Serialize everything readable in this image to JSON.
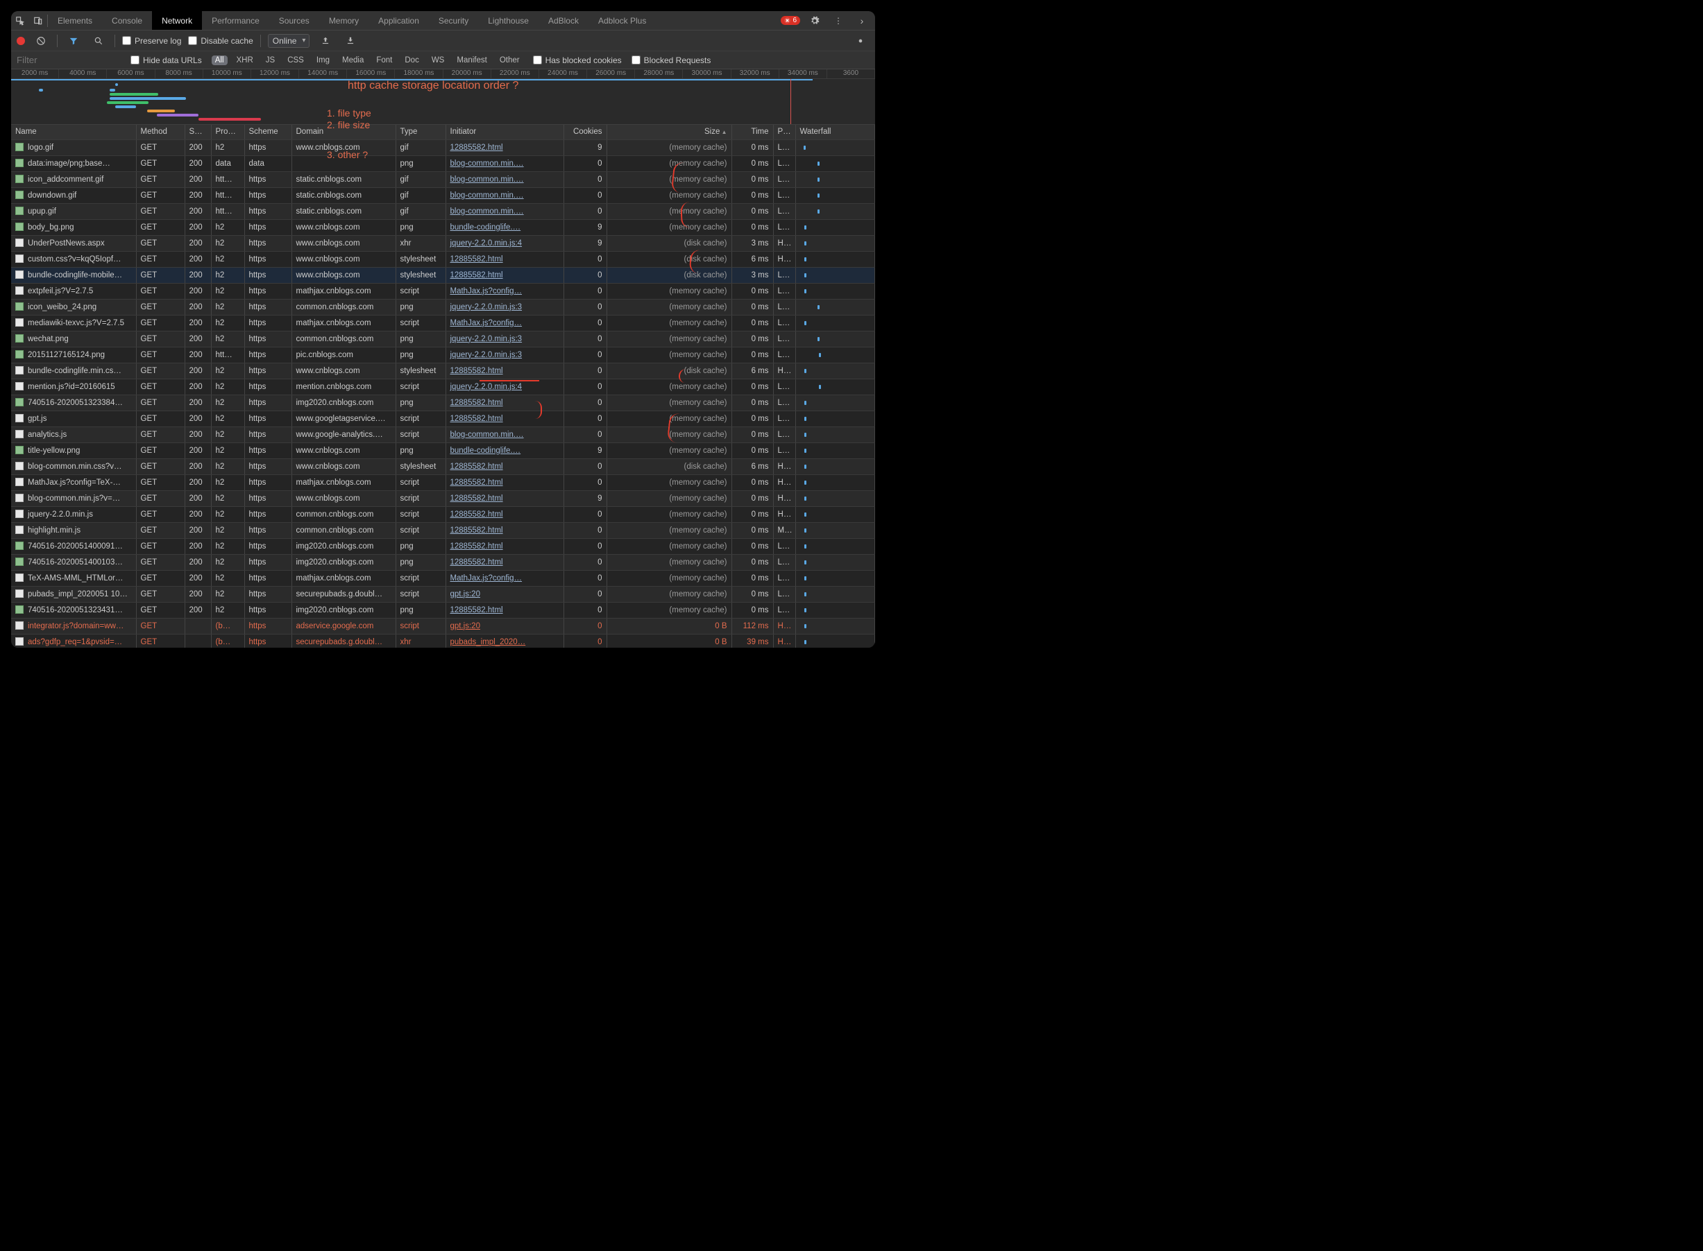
{
  "tabs": {
    "items": [
      "Elements",
      "Console",
      "Network",
      "Performance",
      "Sources",
      "Memory",
      "Application",
      "Security",
      "Lighthouse",
      "AdBlock",
      "Adblock Plus"
    ],
    "active": "Network",
    "error_count": "6"
  },
  "toolbar": {
    "preserve_log": "Preserve log",
    "disable_cache": "Disable cache",
    "throttle": "Online"
  },
  "filterbar": {
    "placeholder": "Filter",
    "hide_data_urls": "Hide data URLs",
    "types": [
      "All",
      "XHR",
      "JS",
      "CSS",
      "Img",
      "Media",
      "Font",
      "Doc",
      "WS",
      "Manifest",
      "Other"
    ],
    "active_type": "All",
    "blocked_cookies": "Has blocked cookies",
    "blocked_requests": "Blocked Requests"
  },
  "overview_ticks": [
    "2000 ms",
    "4000 ms",
    "6000 ms",
    "8000 ms",
    "10000 ms",
    "12000 ms",
    "14000 ms",
    "16000 ms",
    "18000 ms",
    "20000 ms",
    "22000 ms",
    "24000 ms",
    "26000 ms",
    "28000 ms",
    "30000 ms",
    "32000 ms",
    "34000 ms",
    "3600"
  ],
  "annotations": {
    "top": "http cache storage location order ?",
    "lines": [
      "1. file type",
      "2. file size",
      "3. other ?"
    ]
  },
  "columns": [
    "Name",
    "Method",
    "S…",
    "Pro…",
    "Scheme",
    "Domain",
    "Type",
    "Initiator",
    "Cookies",
    "Size",
    "Time",
    "P…",
    "Waterfall"
  ],
  "sort_col": "Size",
  "rows": [
    {
      "name": "logo.gif",
      "method": "GET",
      "status": "200",
      "proto": "h2",
      "scheme": "https",
      "domain": "www.cnblogs.com",
      "type": "gif",
      "init": "12885582.html",
      "cookies": "9",
      "size": "(memory cache)",
      "time": "0 ms",
      "prio": "L…",
      "wf": 5
    },
    {
      "name": "data:image/png;base…",
      "method": "GET",
      "status": "200",
      "proto": "data",
      "scheme": "data",
      "domain": "",
      "type": "png",
      "init": "blog-common.min.…",
      "cookies": "0",
      "size": "(memory cache)",
      "time": "0 ms",
      "prio": "L…",
      "wf": 25
    },
    {
      "name": "icon_addcomment.gif",
      "method": "GET",
      "status": "200",
      "proto": "htt…",
      "scheme": "https",
      "domain": "static.cnblogs.com",
      "type": "gif",
      "init": "blog-common.min.…",
      "cookies": "0",
      "size": "(memory cache)",
      "time": "0 ms",
      "prio": "L…",
      "wf": 25
    },
    {
      "name": "downdown.gif",
      "method": "GET",
      "status": "200",
      "proto": "htt…",
      "scheme": "https",
      "domain": "static.cnblogs.com",
      "type": "gif",
      "init": "blog-common.min.…",
      "cookies": "0",
      "size": "(memory cache)",
      "time": "0 ms",
      "prio": "L…",
      "wf": 25
    },
    {
      "name": "upup.gif",
      "method": "GET",
      "status": "200",
      "proto": "htt…",
      "scheme": "https",
      "domain": "static.cnblogs.com",
      "type": "gif",
      "init": "blog-common.min.…",
      "cookies": "0",
      "size": "(memory cache)",
      "time": "0 ms",
      "prio": "L…",
      "wf": 25
    },
    {
      "name": "body_bg.png",
      "method": "GET",
      "status": "200",
      "proto": "h2",
      "scheme": "https",
      "domain": "www.cnblogs.com",
      "type": "png",
      "init": "bundle-codinglife.…",
      "cookies": "9",
      "size": "(memory cache)",
      "time": "0 ms",
      "prio": "L…",
      "wf": 6
    },
    {
      "name": "UnderPostNews.aspx",
      "method": "GET",
      "status": "200",
      "proto": "h2",
      "scheme": "https",
      "domain": "www.cnblogs.com",
      "type": "xhr",
      "init": "jquery-2.2.0.min.js:4",
      "cookies": "9",
      "size": "(disk cache)",
      "time": "3 ms",
      "prio": "H…",
      "wf": 6
    },
    {
      "name": "custom.css?v=kqQ5Iopf…",
      "method": "GET",
      "status": "200",
      "proto": "h2",
      "scheme": "https",
      "domain": "www.cnblogs.com",
      "type": "stylesheet",
      "init": "12885582.html",
      "cookies": "0",
      "size": "(disk cache)",
      "time": "6 ms",
      "prio": "H…",
      "wf": 6
    },
    {
      "name": "bundle-codinglife-mobile…",
      "method": "GET",
      "status": "200",
      "proto": "h2",
      "scheme": "https",
      "domain": "www.cnblogs.com",
      "type": "stylesheet",
      "init": "12885582.html",
      "cookies": "0",
      "size": "(disk cache)",
      "time": "3 ms",
      "prio": "L…",
      "wf": 6,
      "sel": true
    },
    {
      "name": "extpfeil.js?V=2.7.5",
      "method": "GET",
      "status": "200",
      "proto": "h2",
      "scheme": "https",
      "domain": "mathjax.cnblogs.com",
      "type": "script",
      "init": "MathJax.js?config…",
      "cookies": "0",
      "size": "(memory cache)",
      "time": "0 ms",
      "prio": "L…",
      "wf": 6
    },
    {
      "name": "icon_weibo_24.png",
      "method": "GET",
      "status": "200",
      "proto": "h2",
      "scheme": "https",
      "domain": "common.cnblogs.com",
      "type": "png",
      "init": "jquery-2.2.0.min.js:3",
      "cookies": "0",
      "size": "(memory cache)",
      "time": "0 ms",
      "prio": "L…",
      "wf": 25
    },
    {
      "name": "mediawiki-texvc.js?V=2.7.5",
      "method": "GET",
      "status": "200",
      "proto": "h2",
      "scheme": "https",
      "domain": "mathjax.cnblogs.com",
      "type": "script",
      "init": "MathJax.js?config…",
      "cookies": "0",
      "size": "(memory cache)",
      "time": "0 ms",
      "prio": "L…",
      "wf": 6
    },
    {
      "name": "wechat.png",
      "method": "GET",
      "status": "200",
      "proto": "h2",
      "scheme": "https",
      "domain": "common.cnblogs.com",
      "type": "png",
      "init": "jquery-2.2.0.min.js:3",
      "cookies": "0",
      "size": "(memory cache)",
      "time": "0 ms",
      "prio": "L…",
      "wf": 25
    },
    {
      "name": "20151127165124.png",
      "method": "GET",
      "status": "200",
      "proto": "htt…",
      "scheme": "https",
      "domain": "pic.cnblogs.com",
      "type": "png",
      "init": "jquery-2.2.0.min.js:3",
      "cookies": "0",
      "size": "(memory cache)",
      "time": "0 ms",
      "prio": "L…",
      "wf": 27
    },
    {
      "name": "bundle-codinglife.min.cs…",
      "method": "GET",
      "status": "200",
      "proto": "h2",
      "scheme": "https",
      "domain": "www.cnblogs.com",
      "type": "stylesheet",
      "init": "12885582.html",
      "cookies": "0",
      "size": "(disk cache)",
      "time": "6 ms",
      "prio": "H…",
      "wf": 6
    },
    {
      "name": "mention.js?id=20160615",
      "method": "GET",
      "status": "200",
      "proto": "h2",
      "scheme": "https",
      "domain": "mention.cnblogs.com",
      "type": "script",
      "init": "jquery-2.2.0.min.js:4",
      "cookies": "0",
      "size": "(memory cache)",
      "time": "0 ms",
      "prio": "L…",
      "wf": 27
    },
    {
      "name": "740516-2020051323384…",
      "method": "GET",
      "status": "200",
      "proto": "h2",
      "scheme": "https",
      "domain": "img2020.cnblogs.com",
      "type": "png",
      "init": "12885582.html",
      "cookies": "0",
      "size": "(memory cache)",
      "time": "0 ms",
      "prio": "L…",
      "wf": 6
    },
    {
      "name": "gpt.js",
      "method": "GET",
      "status": "200",
      "proto": "h2",
      "scheme": "https",
      "domain": "www.googletagservice.…",
      "type": "script",
      "init": "12885582.html",
      "cookies": "0",
      "size": "(memory cache)",
      "time": "0 ms",
      "prio": "L…",
      "wf": 6
    },
    {
      "name": "analytics.js",
      "method": "GET",
      "status": "200",
      "proto": "h2",
      "scheme": "https",
      "domain": "www.google-analytics.…",
      "type": "script",
      "init": "blog-common.min.…",
      "cookies": "0",
      "size": "(memory cache)",
      "time": "0 ms",
      "prio": "L…",
      "wf": 6
    },
    {
      "name": "title-yellow.png",
      "method": "GET",
      "status": "200",
      "proto": "h2",
      "scheme": "https",
      "domain": "www.cnblogs.com",
      "type": "png",
      "init": "bundle-codinglife.…",
      "cookies": "9",
      "size": "(memory cache)",
      "time": "0 ms",
      "prio": "L…",
      "wf": 6
    },
    {
      "name": "blog-common.min.css?v…",
      "method": "GET",
      "status": "200",
      "proto": "h2",
      "scheme": "https",
      "domain": "www.cnblogs.com",
      "type": "stylesheet",
      "init": "12885582.html",
      "cookies": "0",
      "size": "(disk cache)",
      "time": "6 ms",
      "prio": "H…",
      "wf": 6
    },
    {
      "name": "MathJax.js?config=TeX-…",
      "method": "GET",
      "status": "200",
      "proto": "h2",
      "scheme": "https",
      "domain": "mathjax.cnblogs.com",
      "type": "script",
      "init": "12885582.html",
      "cookies": "0",
      "size": "(memory cache)",
      "time": "0 ms",
      "prio": "H…",
      "wf": 6
    },
    {
      "name": "blog-common.min.js?v=…",
      "method": "GET",
      "status": "200",
      "proto": "h2",
      "scheme": "https",
      "domain": "www.cnblogs.com",
      "type": "script",
      "init": "12885582.html",
      "cookies": "9",
      "size": "(memory cache)",
      "time": "0 ms",
      "prio": "H…",
      "wf": 6
    },
    {
      "name": "jquery-2.2.0.min.js",
      "method": "GET",
      "status": "200",
      "proto": "h2",
      "scheme": "https",
      "domain": "common.cnblogs.com",
      "type": "script",
      "init": "12885582.html",
      "cookies": "0",
      "size": "(memory cache)",
      "time": "0 ms",
      "prio": "H…",
      "wf": 6
    },
    {
      "name": "highlight.min.js",
      "method": "GET",
      "status": "200",
      "proto": "h2",
      "scheme": "https",
      "domain": "common.cnblogs.com",
      "type": "script",
      "init": "12885582.html",
      "cookies": "0",
      "size": "(memory cache)",
      "time": "0 ms",
      "prio": "M…",
      "wf": 6
    },
    {
      "name": "740516-2020051400091…",
      "method": "GET",
      "status": "200",
      "proto": "h2",
      "scheme": "https",
      "domain": "img2020.cnblogs.com",
      "type": "png",
      "init": "12885582.html",
      "cookies": "0",
      "size": "(memory cache)",
      "time": "0 ms",
      "prio": "L…",
      "wf": 6
    },
    {
      "name": "740516-2020051400103…",
      "method": "GET",
      "status": "200",
      "proto": "h2",
      "scheme": "https",
      "domain": "img2020.cnblogs.com",
      "type": "png",
      "init": "12885582.html",
      "cookies": "0",
      "size": "(memory cache)",
      "time": "0 ms",
      "prio": "L…",
      "wf": 6
    },
    {
      "name": "TeX-AMS-MML_HTMLor…",
      "method": "GET",
      "status": "200",
      "proto": "h2",
      "scheme": "https",
      "domain": "mathjax.cnblogs.com",
      "type": "script",
      "init": "MathJax.js?config…",
      "cookies": "0",
      "size": "(memory cache)",
      "time": "0 ms",
      "prio": "L…",
      "wf": 6
    },
    {
      "name": "pubads_impl_2020051 10…",
      "method": "GET",
      "status": "200",
      "proto": "h2",
      "scheme": "https",
      "domain": "securepubads.g.doubl…",
      "type": "script",
      "init": "gpt.js:20",
      "cookies": "0",
      "size": "(memory cache)",
      "time": "0 ms",
      "prio": "L…",
      "wf": 6
    },
    {
      "name": "740516-2020051323431…",
      "method": "GET",
      "status": "200",
      "proto": "h2",
      "scheme": "https",
      "domain": "img2020.cnblogs.com",
      "type": "png",
      "init": "12885582.html",
      "cookies": "0",
      "size": "(memory cache)",
      "time": "0 ms",
      "prio": "L…",
      "wf": 6
    },
    {
      "name": "integrator.js?domain=ww…",
      "method": "GET",
      "status": "",
      "proto": "(b…",
      "scheme": "https",
      "domain": "adservice.google.com",
      "type": "script",
      "init": "gpt.js:20",
      "cookies": "0",
      "size": "0 B",
      "time": "112 ms",
      "prio": "H…",
      "wf": 6,
      "err": true
    },
    {
      "name": "ads?gdfp_req=1&pvsid=…",
      "method": "GET",
      "status": "",
      "proto": "(b…",
      "scheme": "https",
      "domain": "securepubads.g.doubl…",
      "type": "xhr",
      "init": "pubads_impl_2020…",
      "cookies": "0",
      "size": "0 B",
      "time": "39 ms",
      "prio": "H…",
      "wf": 6,
      "err": true
    }
  ]
}
